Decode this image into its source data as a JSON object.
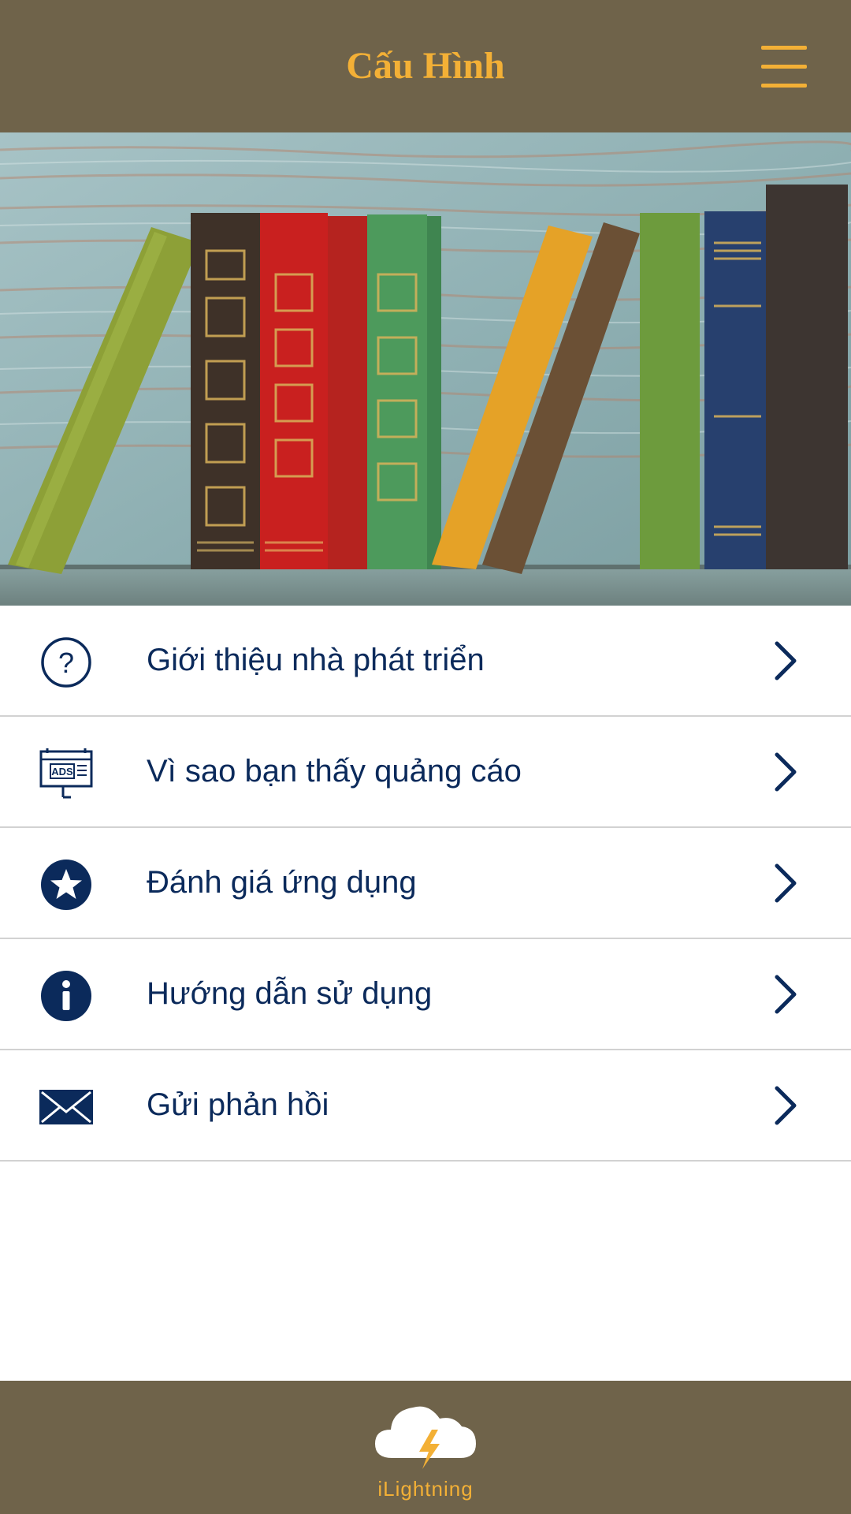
{
  "header": {
    "title": "Cấu Hình",
    "menu_icon": "hamburger-menu-icon"
  },
  "banner": {
    "image": "books-on-wooden-shelf-photo"
  },
  "menu": {
    "items": [
      {
        "label": "Giới thiệu nhà phát triển",
        "icon": "question-circle-icon"
      },
      {
        "label": "Vì sao bạn thấy quảng cáo",
        "icon": "ads-billboard-icon",
        "icon_text": "ADS"
      },
      {
        "label": "Đánh giá ứng dụng",
        "icon": "star-circle-icon"
      },
      {
        "label": "Hướng dẫn sử dụng",
        "icon": "info-circle-icon"
      },
      {
        "label": "Gửi phản hồi",
        "icon": "envelope-icon"
      }
    ]
  },
  "footer": {
    "logo_text": "iLightning",
    "logo_icon": "cloud-lightning-icon"
  },
  "colors": {
    "header_bg": "#6f634a",
    "accent": "#f3b036",
    "text": "#0b2a5b",
    "divider": "#d2d2d2"
  }
}
